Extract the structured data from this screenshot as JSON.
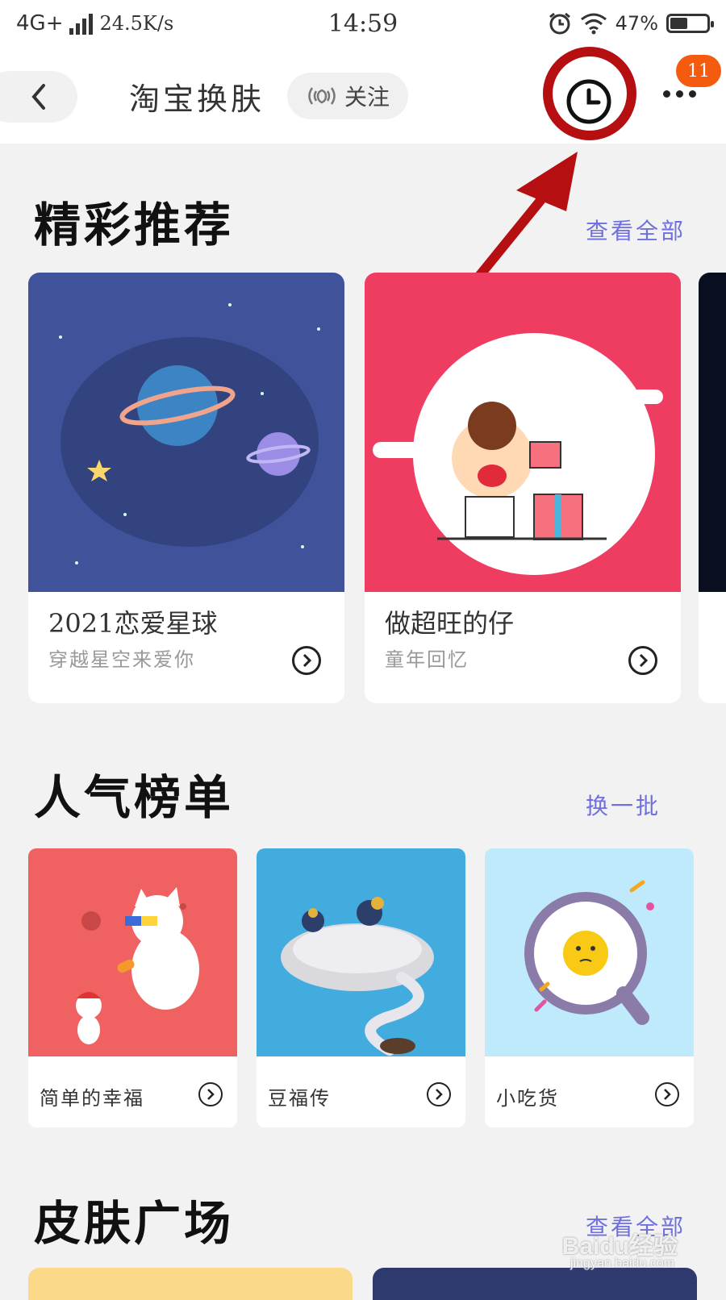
{
  "status_bar": {
    "network": "4G+",
    "speed": "24.5K/s",
    "time": "14:59",
    "battery": "47%",
    "battery_level": 0.47
  },
  "header": {
    "title": "淘宝换肤",
    "follow_label": "关注",
    "notification_count": "11"
  },
  "sections": {
    "featured": {
      "title": "精彩推荐",
      "link": "查看全部",
      "cards": [
        {
          "name": "2021恋爱星球",
          "subtitle": "穿越星空来爱你",
          "bg": "#40539a"
        },
        {
          "name": "做超旺的仔",
          "subtitle": "童年回忆",
          "bg": "#ef3d61"
        }
      ]
    },
    "popular": {
      "title": "人气榜单",
      "link": "换一批",
      "cards": [
        {
          "name": "简单的幸福",
          "bg": "#f06262"
        },
        {
          "name": "豆福传",
          "bg": "#42acdf"
        },
        {
          "name": "小吃货",
          "bg": "#bfeafb"
        }
      ]
    },
    "plaza": {
      "title": "皮肤广场",
      "link": "查看全部"
    }
  },
  "annotation": {
    "color": "#b50f12"
  },
  "watermark": {
    "brand": "Baidu经验",
    "url": "jingyan.baidu.com"
  }
}
